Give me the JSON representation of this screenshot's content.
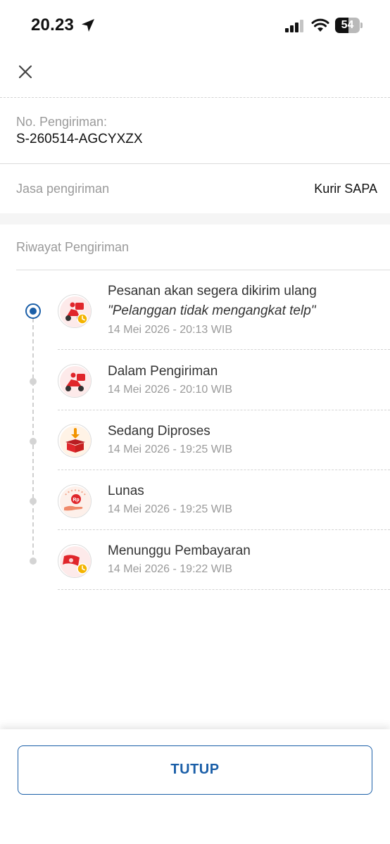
{
  "status_bar": {
    "time": "20.23",
    "battery_level": "54",
    "icons": [
      "location-arrow-icon",
      "signal-icon",
      "wifi-icon",
      "battery-icon"
    ]
  },
  "header": {
    "close_icon": "close-icon"
  },
  "shipment": {
    "number_label": "No. Pengiriman:",
    "number_value": "S-260514-AGCYXZX",
    "service_label": "Jasa pengiriman",
    "service_value": "Kurir SAPA"
  },
  "history": {
    "title": "Riwayat Pengiriman",
    "events": [
      {
        "title": "Pesanan akan segera dikirim ulang",
        "note": "\"Pelanggan tidak mengangkat telp\"",
        "time": "14 Mei 2026 - 20:13 WIB",
        "icon": "scooter-clock-icon",
        "active": true
      },
      {
        "title": "Dalam Pengiriman",
        "time": "14 Mei 2026 - 20:10 WIB",
        "icon": "scooter-icon",
        "active": false
      },
      {
        "title": "Sedang Diproses",
        "time": "14 Mei 2026 - 19:25 WIB",
        "icon": "box-icon",
        "active": false
      },
      {
        "title": "Lunas",
        "time": "14 Mei 2026 - 19:25 WIB",
        "icon": "paid-hand-icon",
        "active": false
      },
      {
        "title": "Menunggu Pembayaran",
        "time": "14 Mei 2026 - 19:22 WIB",
        "icon": "money-clock-icon",
        "active": false
      }
    ]
  },
  "footer": {
    "close_label": "TUTUP"
  },
  "colors": {
    "accent": "#1b5fa8",
    "brand_red": "#e0262b",
    "muted_text": "#9a9a9a"
  }
}
